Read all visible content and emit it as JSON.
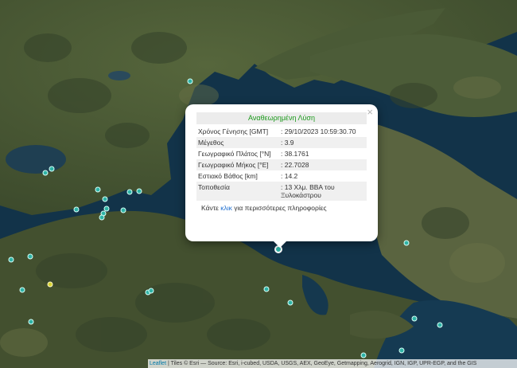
{
  "map": {
    "markers": [
      {
        "id": "m1",
        "color": "teal"
      },
      {
        "id": "m2",
        "color": "teal"
      },
      {
        "id": "m3",
        "color": "teal"
      },
      {
        "id": "m4",
        "color": "teal"
      },
      {
        "id": "m5",
        "color": "teal"
      },
      {
        "id": "m6",
        "color": "teal"
      },
      {
        "id": "m7",
        "color": "teal"
      },
      {
        "id": "m8",
        "color": "teal"
      },
      {
        "id": "m9",
        "color": "teal"
      },
      {
        "id": "m10",
        "color": "teal"
      },
      {
        "id": "m11",
        "color": "teal"
      },
      {
        "id": "m12",
        "color": "teal"
      },
      {
        "id": "m13",
        "color": "teal"
      },
      {
        "id": "m14",
        "color": "teal"
      },
      {
        "id": "m15",
        "color": "teal"
      },
      {
        "id": "m16",
        "color": "teal"
      },
      {
        "id": "m17",
        "color": "teal"
      },
      {
        "id": "m18",
        "color": "teal"
      },
      {
        "id": "m19",
        "color": "teal"
      },
      {
        "id": "m20",
        "color": "teal"
      },
      {
        "id": "m21",
        "color": "teal"
      },
      {
        "id": "m22",
        "color": "teal"
      },
      {
        "id": "m23",
        "color": "teal"
      },
      {
        "id": "m24",
        "color": "yellow"
      },
      {
        "id": "m25",
        "color": "teal"
      },
      {
        "id": "m26",
        "color": "teal"
      },
      {
        "id": "m27",
        "color": "teal",
        "selected": true
      }
    ]
  },
  "popup": {
    "close": "×",
    "title": "Αναθεωρημένη Λύση",
    "rows": [
      {
        "label": "Χρόνος Γένησης [GMT]",
        "value": ": 29/10/2023 10:59:30.70"
      },
      {
        "label": "Μέγεθος",
        "value": ": 3.9"
      },
      {
        "label": "Γεωγραφικό Πλάτος [°N]",
        "value": ": 38.1761"
      },
      {
        "label": "Γεωγραφικό Μήκος [°E]",
        "value": ": 22.7028"
      },
      {
        "label": "Εστιακό Βάθος [km]",
        "value": ": 14.2"
      },
      {
        "label": "Τοποθεσία",
        "value": ": 13 Χλμ. ΒΒΑ του Ξυλοκάστρου"
      }
    ],
    "more_prefix": "Κάντε ",
    "more_link": "κλικ",
    "more_suffix": " για περισσότερες πληροφορίες"
  },
  "attribution": {
    "leaflet": "Leaflet",
    "text": " | Tiles © Esri — Source: Esri, i-cubed, USDA, USGS, AEX, GeoEye, Getmapping, Aerogrid, IGN, IGP, UPR-EGP, and the GIS"
  },
  "colors": {
    "marker": "#2fb3a6",
    "marker_yellow": "#d7d332",
    "popup_title": "#1d9a1d",
    "link": "#1f6fd0"
  }
}
